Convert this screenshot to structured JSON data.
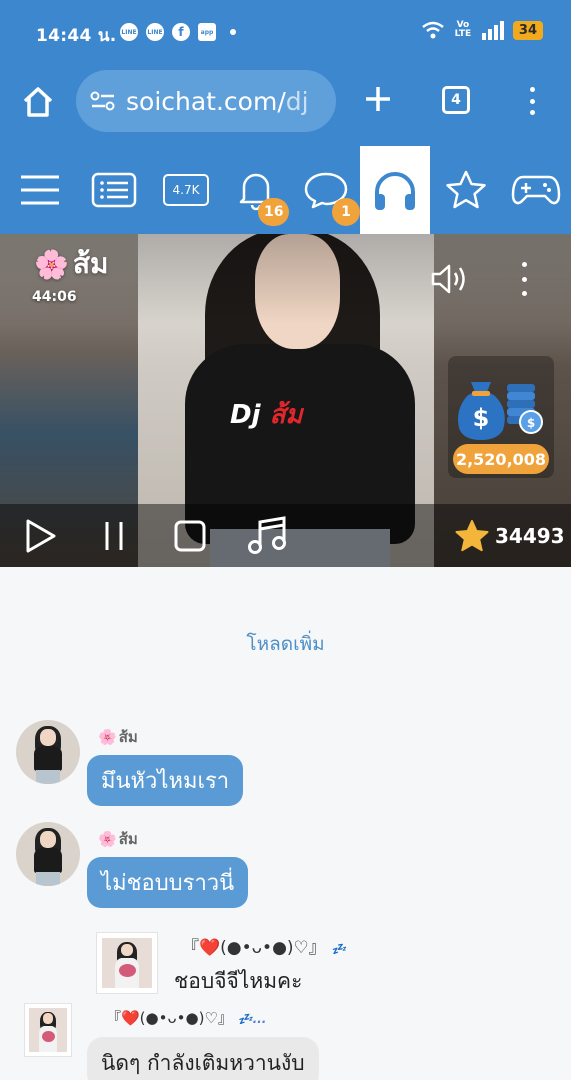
{
  "status_bar": {
    "time": "14:44 น.",
    "apps": [
      "LINE",
      "LINE",
      "f",
      "app"
    ],
    "network": "Vo LTE",
    "battery": "34"
  },
  "browser": {
    "url_domain": "soichat.com/",
    "url_path": "dj",
    "tab_count": "4"
  },
  "site_nav": {
    "listeners_label": "4.7K",
    "notifications_badge": "16",
    "messages_badge": "1",
    "icons": [
      "menu-icon",
      "list-icon",
      "listeners-icon",
      "bell-icon",
      "chat-icon",
      "headphones-icon",
      "star-icon",
      "gamepad-icon"
    ]
  },
  "video": {
    "dj_emoji": "🌸",
    "dj_name": "ส้ม",
    "duration": "44:06",
    "shirt_logo_latin": "Dj",
    "shirt_logo_thai": "ส้ม",
    "coins": "2,520,008",
    "stars": "34493"
  },
  "chat": {
    "load_more": "โหลดเพิ่ม",
    "messages": [
      {
        "sender_emoji": "🌸",
        "sender": "ส้ม",
        "text": "มึนหัวไหมเรา"
      },
      {
        "sender_emoji": "🌸",
        "sender": "ส้ม",
        "text": "ไม่ชอบบราวนี่"
      },
      {
        "sender": "『❤️(●•ᴗ•●)♡』",
        "zzz": "💤",
        "text": "ชอบจีจีไหมคะ"
      },
      {
        "sender": "『❤️(●•ᴗ•●)♡』",
        "zzz": "💤...",
        "text": "นิดๆ กำลังเติมหวานงับ"
      }
    ]
  }
}
